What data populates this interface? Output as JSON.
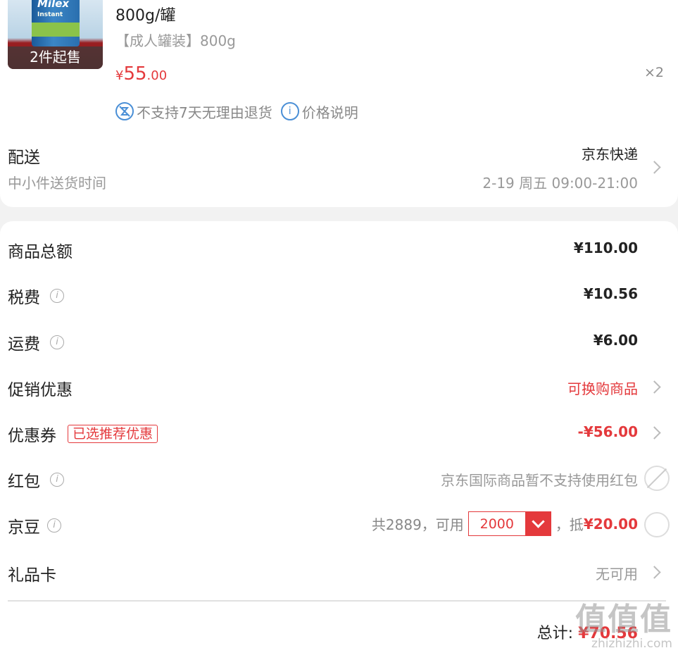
{
  "product": {
    "thumb_brand": "Milex",
    "thumb_sub": "Instant",
    "min_purchase_badge": "2件起售",
    "title": "800g/罐",
    "spec": "【成人罐装】800g",
    "price_symbol": "¥",
    "price_int": "55",
    "price_dec": ".00",
    "quantity": "×2",
    "policy_no_return": "不支持7天无理由退货",
    "policy_price_note": "价格说明"
  },
  "delivery": {
    "title": "配送",
    "subtitle": "中小件送货时间",
    "method": "京东快递",
    "time": "2-19 周五 09:00-21:00"
  },
  "summary": {
    "goods_total": {
      "label": "商品总额",
      "value": "¥110.00"
    },
    "tax": {
      "label": "税费",
      "value": "¥10.56"
    },
    "shipping": {
      "label": "运费",
      "value": "¥6.00"
    },
    "promotion": {
      "label": "促销优惠",
      "value": "可换购商品"
    },
    "coupon": {
      "label": "优惠券",
      "tag": "已选推荐优惠",
      "value": "-¥56.00"
    },
    "red_packet": {
      "label": "红包",
      "value": "京东国际商品暂不支持使用红包"
    },
    "jd_beans": {
      "label": "京豆",
      "prefix": "共2889，可用",
      "selected": "2000",
      "suffix": "，抵",
      "deduct": "¥20.00"
    },
    "gift_card": {
      "label": "礼品卡",
      "value": "无可用"
    }
  },
  "total": {
    "label": "总计:",
    "amount": "¥70.56"
  },
  "watermark": {
    "big": "值值值",
    "small": "zhizhizhi.com"
  },
  "colors": {
    "accent": "#e4393c",
    "link_blue": "#4a8fd6"
  }
}
